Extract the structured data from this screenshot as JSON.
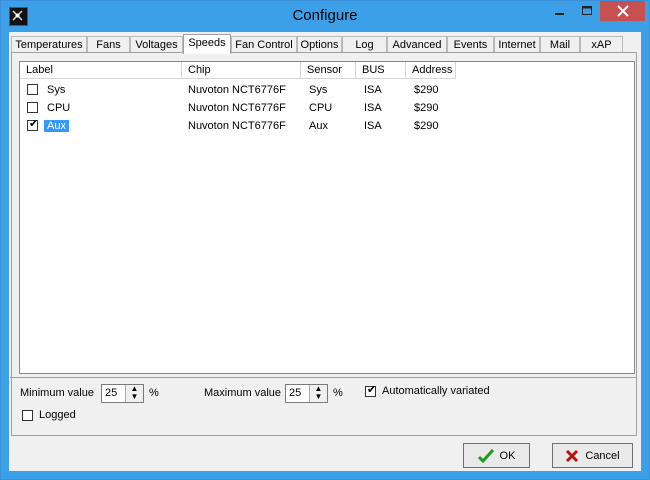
{
  "window": {
    "title": "Configure"
  },
  "tabs": [
    "Temperatures",
    "Fans",
    "Voltages",
    "Speeds",
    "Fan Control",
    "Options",
    "Log",
    "Advanced",
    "Events",
    "Internet",
    "Mail",
    "xAP"
  ],
  "active_tab": "Speeds",
  "columns": [
    "Label",
    "Chip",
    "Sensor",
    "BUS",
    "Address"
  ],
  "rows": [
    {
      "checked": false,
      "label": "Sys",
      "chip": "Nuvoton NCT6776F",
      "sensor": "Sys",
      "bus": "ISA",
      "address": "$290"
    },
    {
      "checked": false,
      "label": "CPU",
      "chip": "Nuvoton NCT6776F",
      "sensor": "CPU",
      "bus": "ISA",
      "address": "$290"
    },
    {
      "checked": true,
      "label": "Aux",
      "chip": "Nuvoton NCT6776F",
      "sensor": "Aux",
      "bus": "ISA",
      "address": "$290"
    }
  ],
  "controls": {
    "min_label": "Minimum value",
    "min_value": "25",
    "min_unit": "%",
    "max_label": "Maximum value",
    "max_value": "25",
    "max_unit": "%",
    "auto_label": "Automatically variated",
    "auto_checked": true,
    "logged_label": "Logged",
    "logged_checked": false
  },
  "buttons": {
    "ok": "OK",
    "cancel": "Cancel"
  }
}
